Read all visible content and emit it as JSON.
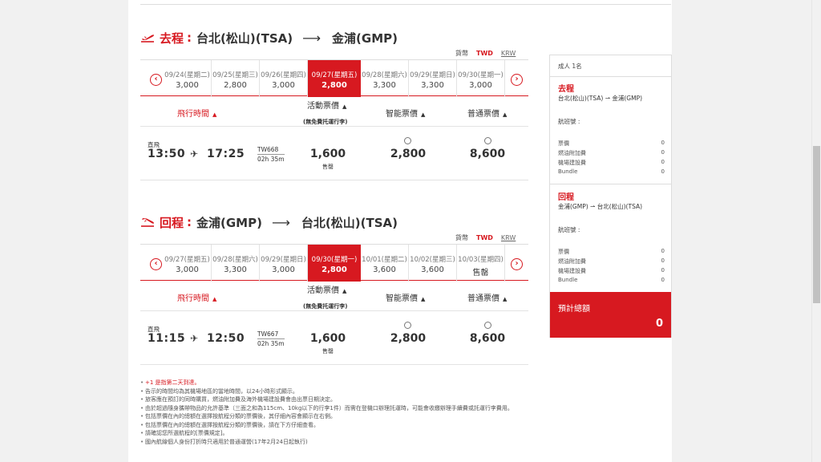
{
  "outbound": {
    "label": "去程",
    "sep": ":",
    "from": "台北(松山)(TSA)",
    "to": "金浦(GMP)",
    "currency": {
      "label": "貨幣",
      "twd": "TWD",
      "krw": "KRW"
    },
    "dates": [
      {
        "date": "09/24(星期二)",
        "price": "3,000"
      },
      {
        "date": "09/25(星期三)",
        "price": "2,800"
      },
      {
        "date": "09/26(星期四)",
        "price": "3,000"
      },
      {
        "date": "09/27(星期五)",
        "price": "2,800",
        "selected": true
      },
      {
        "date": "09/28(星期六)",
        "price": "3,300"
      },
      {
        "date": "09/29(星期日)",
        "price": "3,300"
      },
      {
        "date": "09/30(星期一)",
        "price": "3,000"
      }
    ],
    "flight": {
      "type": "直飛",
      "depart": "13:50",
      "arrive": "17:25",
      "number": "TW668",
      "duration": "02h 35m",
      "promo_price": "1,600",
      "promo_status": "售罄",
      "smart_price": "2,800",
      "regular_price": "8,600"
    }
  },
  "inbound": {
    "label": "回程",
    "sep": ":",
    "from": "金浦(GMP)",
    "to": "台北(松山)(TSA)",
    "currency": {
      "label": "貨幣",
      "twd": "TWD",
      "krw": "KRW"
    },
    "dates": [
      {
        "date": "09/27(星期五)",
        "price": "3,000"
      },
      {
        "date": "09/28(星期六)",
        "price": "3,300"
      },
      {
        "date": "09/29(星期日)",
        "price": "3,000"
      },
      {
        "date": "09/30(星期一)",
        "price": "2,800",
        "selected": true
      },
      {
        "date": "10/01(星期二)",
        "price": "3,600"
      },
      {
        "date": "10/02(星期三)",
        "price": "3,600"
      },
      {
        "date": "10/03(星期四)",
        "price": "售罄"
      }
    ],
    "flight": {
      "type": "直飛",
      "depart": "11:15",
      "arrive": "12:50",
      "number": "TW667",
      "duration": "02h 35m",
      "promo_price": "1,600",
      "promo_status": "售罄",
      "smart_price": "2,800",
      "regular_price": "8,600"
    }
  },
  "columns": {
    "time": "飛行時間",
    "promo": "活動票價",
    "promo_note": "(無免費托運行李)",
    "smart": "智能票價",
    "regular": "普通票價"
  },
  "notes": [
    "+1 是指第二天到達。",
    "告示的時間均為其機場地區的當地時間，以24小時形式顯示。",
    "旅客應在預訂的同時購買，燃油附加費及海外機場建設費會由出票日期決定。",
    "由於超過隨身攜帶物品的允許基準（三面之和為115cm、10kg以下的行李1件）而需在登機口辦理託運時，可能會收繳辦理手續費或託運行李費用。",
    "包括票價在內的總額在選擇按航程分類的票價後，其仔細內容會顯示在右側。",
    "包括票價在內的總額在選擇按航程分類的票價後，請在下方仔細查看。",
    "請確認您所選航程的[票價規定]。",
    "國內航線個人身份打折時只適用於普通運營(17年2月24日起執行)"
  ],
  "sidebar": {
    "pax": "成人 1名",
    "outbound_title": "去程",
    "outbound_route": "台北(松山)(TSA) ⇀ 金浦(GMP)",
    "inbound_title": "回程",
    "inbound_route": "金浦(GMP) ⇀ 台北(松山)(TSA)",
    "flight_no_label": "航班號 :",
    "fees": [
      {
        "label": "票價",
        "value": "0"
      },
      {
        "label": "燃油附加費",
        "value": "0"
      },
      {
        "label": "機場建設費",
        "value": "0"
      },
      {
        "label": "Bundle",
        "value": "0"
      }
    ],
    "total_label": "預計總額",
    "total_value": "0"
  },
  "colors": {
    "brand": "#d71920"
  }
}
